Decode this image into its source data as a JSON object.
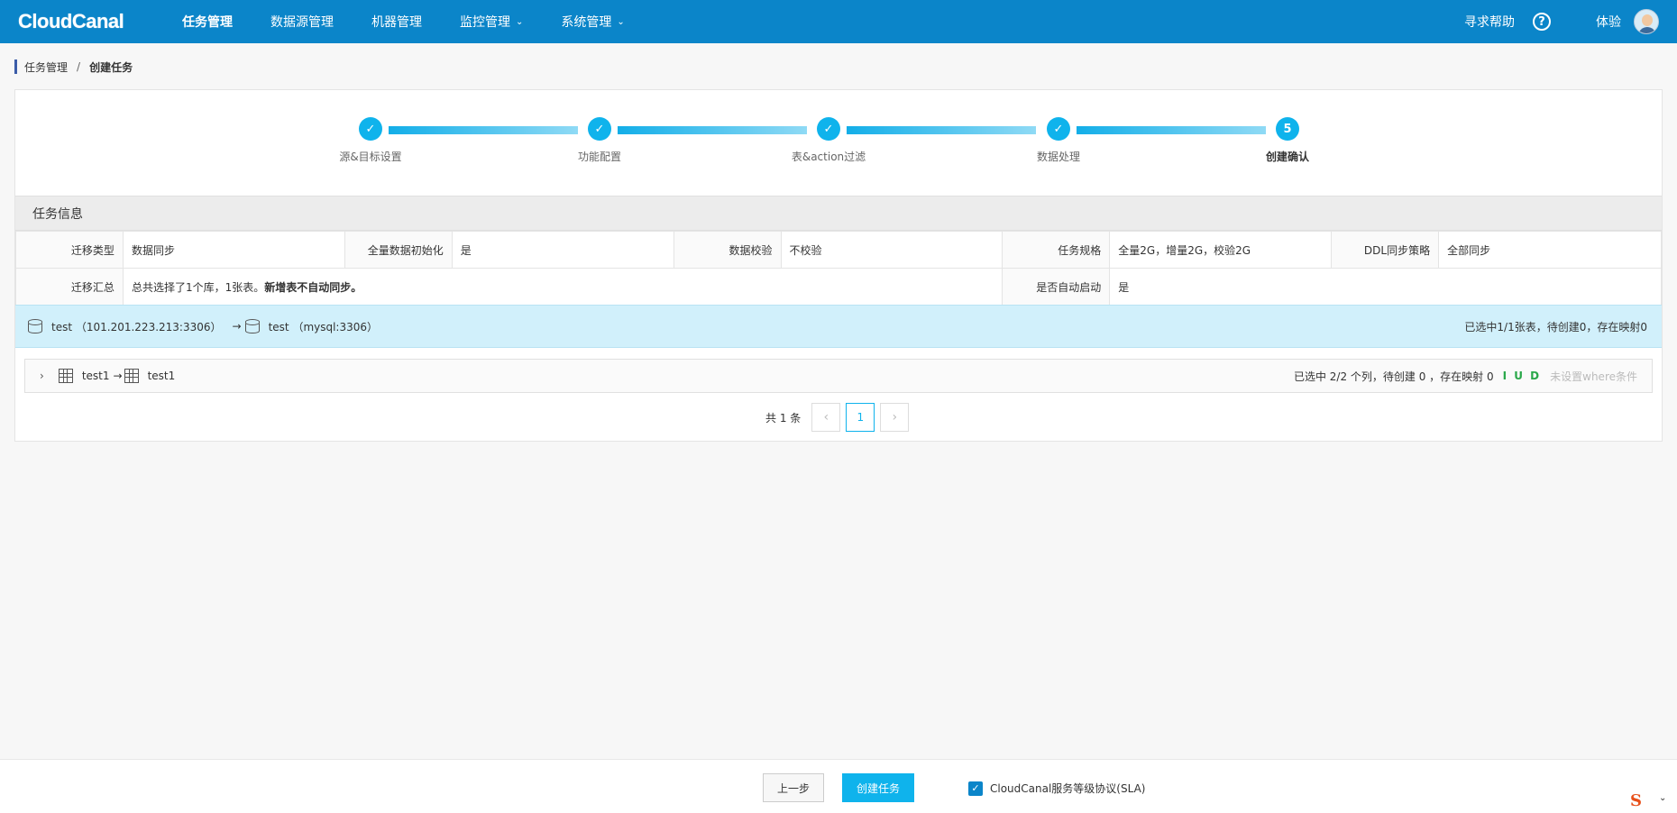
{
  "nav": {
    "logo": "CloudCanal",
    "items": [
      {
        "label": "任务管理",
        "active": true,
        "dropdown": false
      },
      {
        "label": "数据源管理",
        "active": false,
        "dropdown": false
      },
      {
        "label": "机器管理",
        "active": false,
        "dropdown": false
      },
      {
        "label": "监控管理",
        "active": false,
        "dropdown": true
      },
      {
        "label": "系统管理",
        "active": false,
        "dropdown": true
      }
    ],
    "help": "寻求帮助",
    "help_icon": "?",
    "user": "体验"
  },
  "breadcrumb": {
    "parent": "任务管理",
    "separator": "/",
    "current": "创建任务"
  },
  "steps": [
    {
      "label": "源&目标设置",
      "status": "done",
      "mark": "✓"
    },
    {
      "label": "功能配置",
      "status": "done",
      "mark": "✓"
    },
    {
      "label": "表&action过滤",
      "status": "done",
      "mark": "✓"
    },
    {
      "label": "数据处理",
      "status": "done",
      "mark": "✓"
    },
    {
      "label": "创建确认",
      "status": "current",
      "mark": "5"
    }
  ],
  "task_info": {
    "title": "任务信息",
    "row1": [
      {
        "key": "迁移类型",
        "value": "数据同步"
      },
      {
        "key": "全量数据初始化",
        "value": "是"
      },
      {
        "key": "数据校验",
        "value": "不校验"
      },
      {
        "key": "任务规格",
        "value": "全量2G，增量2G，校验2G"
      },
      {
        "key": "DDL同步策略",
        "value": "全部同步"
      }
    ],
    "summary_key": "迁移汇总",
    "summary_text": "总共选择了1个库，1张表。",
    "summary_bold": "新增表不自动同步。",
    "autostart_key": "是否自动启动",
    "autostart_value": "是"
  },
  "db_mapping": {
    "source": "test （101.201.223.213:3306）",
    "arrow": "→",
    "target": "test （mysql:3306）",
    "status": "已选中1/1张表，待创建0，存在映射0"
  },
  "table_mapping": {
    "expand": "›",
    "source": "test1",
    "arrow": "→",
    "target": "test1",
    "status": "已选中 2/2 个列，待创建 0 ，存在映射 0",
    "actions": "I U D",
    "where": "未设置where条件"
  },
  "pagination": {
    "total": "共 1 条",
    "prev": "‹",
    "page": "1",
    "next": "›"
  },
  "footer": {
    "prev_label": "上一步",
    "create_label": "创建任务",
    "sla_checked": true,
    "sla_mark": "✓",
    "sla_label": "CloudCanal服务等级协议(SLA)"
  },
  "ime": {
    "glyph": "S",
    "caret": "⌄"
  },
  "colors": {
    "nav_bg": "#0b85c9",
    "accent": "#0fb3ec",
    "db_bar_bg": "#d1f0fb",
    "iud": "#2aa84a"
  }
}
